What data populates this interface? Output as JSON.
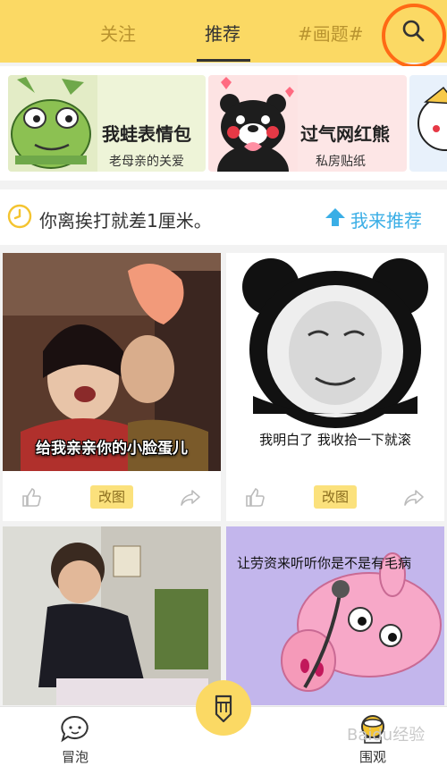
{
  "header": {
    "tabs": [
      {
        "label": "关注",
        "active": false
      },
      {
        "label": "推荐",
        "active": true
      },
      {
        "label": "#画题#",
        "active": false
      }
    ],
    "search_icon": "search-icon",
    "accent_color": "#fbd964"
  },
  "banners": [
    {
      "title": "我蛙表情包",
      "subtitle": "老母亲的关爱"
    },
    {
      "title": "过气网红熊",
      "subtitle": "私房贴纸"
    }
  ],
  "notice": {
    "text": "你离挨打就差1厘米。",
    "recommend_label": "我来推荐"
  },
  "feed": [
    {
      "caption": "给我亲亲你的小脸蛋儿",
      "edit_label": "改图"
    },
    {
      "caption": "我明白了  我收拾一下就滚",
      "edit_label": "改图"
    },
    {
      "caption": ""
    },
    {
      "caption": "让劳资来听听你是不是有毛病"
    }
  ],
  "bottom_nav": {
    "left_label": "冒泡",
    "right_label": "围观"
  },
  "watermark": "Baidu经验"
}
